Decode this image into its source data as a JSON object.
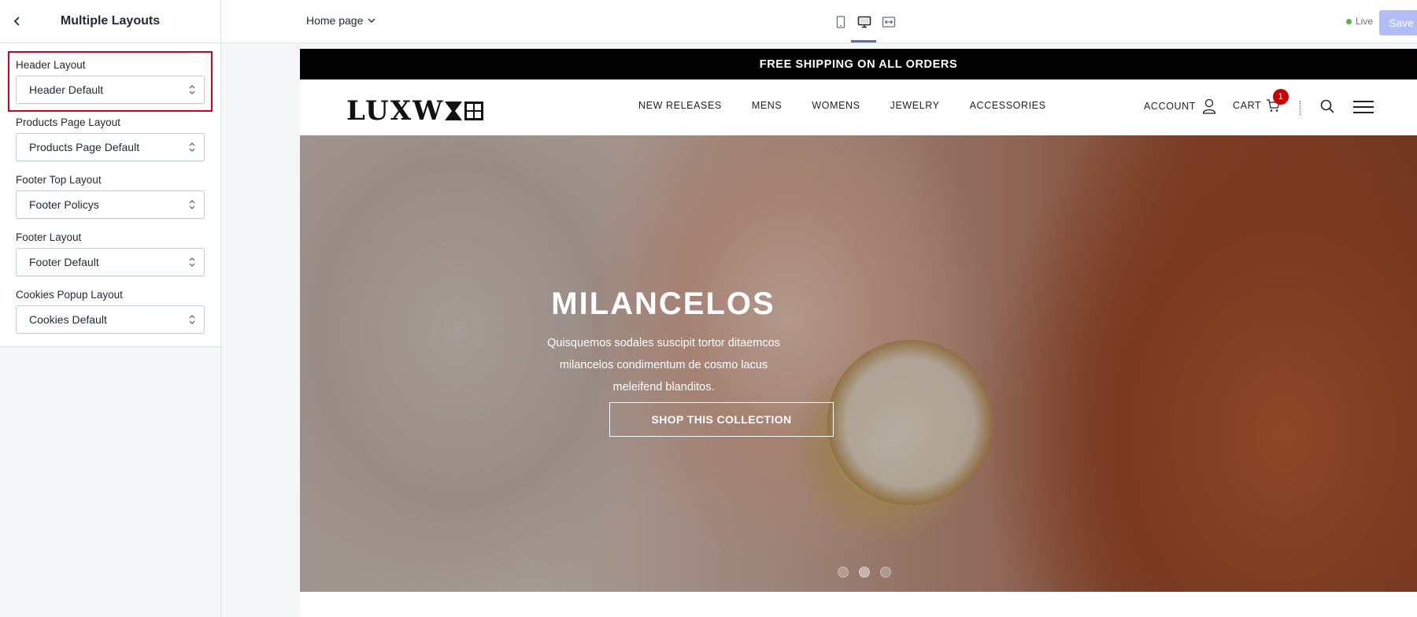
{
  "sidebar": {
    "title": "Multiple Layouts",
    "fields": [
      {
        "label": "Header Layout",
        "value": "Header Default"
      },
      {
        "label": "Products Page Layout",
        "value": "Products Page Default"
      },
      {
        "label": "Footer Top Layout",
        "value": "Footer Policys"
      },
      {
        "label": "Footer Layout",
        "value": "Footer Default"
      },
      {
        "label": "Cookies Popup Layout",
        "value": "Cookies Default"
      }
    ]
  },
  "topbar": {
    "page_select": "Home page",
    "devices": [
      "mobile",
      "desktop",
      "full-width"
    ],
    "active_device": "desktop",
    "status": "Live",
    "save_label": "Save"
  },
  "preview": {
    "announcement": "FREE SHIPPING ON ALL ORDERS",
    "logo_text": "LUXW",
    "nav": [
      "NEW RELEASES",
      "MENS",
      "WOMENS",
      "JEWELRY",
      "ACCESSORIES"
    ],
    "account_label": "ACCOUNT",
    "cart_label": "CART",
    "cart_count": "1",
    "hero": {
      "title": "MILANCELOS",
      "subtitle": "Quisquemos sodales suscipit tortor ditaemcos milancelos condimentum de cosmo lacus meleifend blanditos.",
      "cta": "SHOP THIS COLLECTION",
      "slides": 3,
      "active_slide": 1
    }
  },
  "colors": {
    "highlight": "#d0021b",
    "accent": "#5c6ac4",
    "badge": "#cc0000"
  }
}
